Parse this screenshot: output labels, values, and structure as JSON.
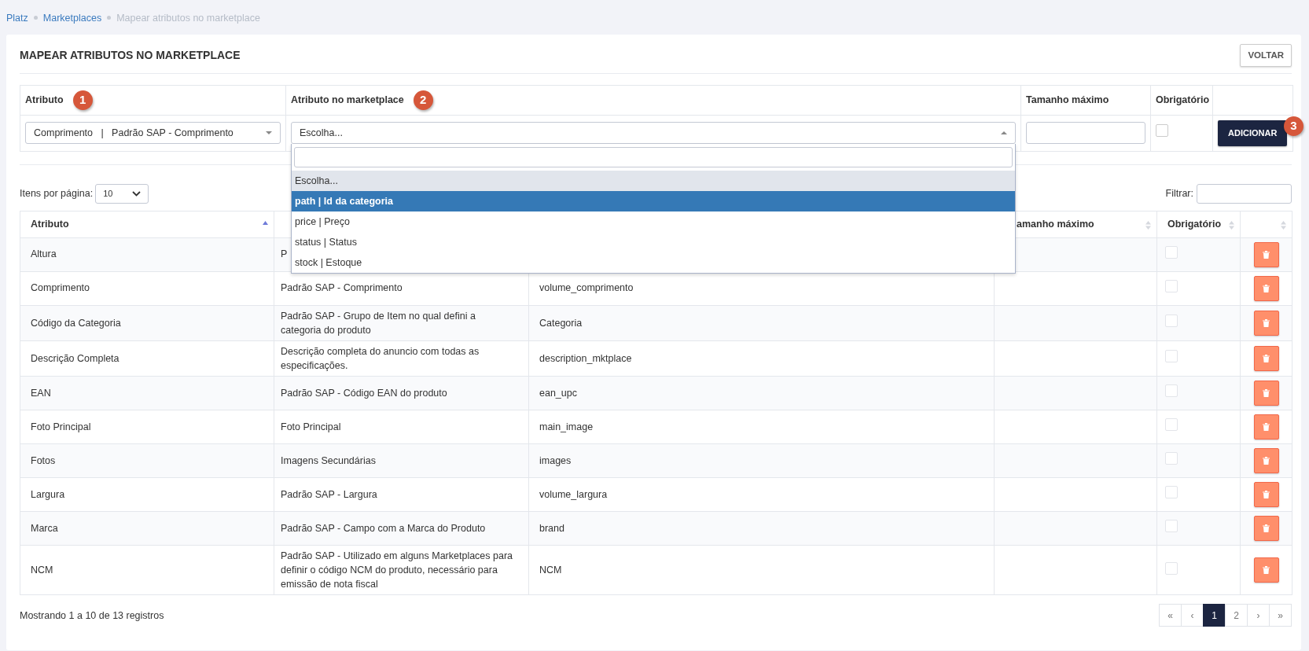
{
  "breadcrumb": [
    {
      "label": "Platz",
      "current": false
    },
    {
      "label": "Marketplaces",
      "current": false
    },
    {
      "label": "Mapear atributos no marketplace",
      "current": true
    }
  ],
  "page_title": "MAPEAR ATRIBUTOS NO MARKETPLACE",
  "back_button": "VOLTAR",
  "form": {
    "columns": [
      {
        "label": "Atributo",
        "marker": "1"
      },
      {
        "label": "Atributo no marketplace",
        "marker": "2"
      },
      {
        "label": "Tamanho máximo"
      },
      {
        "label": "Obrigatório"
      }
    ],
    "attribute_select": {
      "value": "Comprimento   |   Padrão SAP - Comprimento"
    },
    "marketplace_select": {
      "value": "Escolha...",
      "expanded": true,
      "options": [
        {
          "label": "Escolha...",
          "selected": true,
          "highlighted": false
        },
        {
          "label": "path | Id da categoria",
          "selected": false,
          "highlighted": true
        },
        {
          "label": "price | Preço",
          "selected": false,
          "highlighted": false
        },
        {
          "label": "status | Status",
          "selected": false,
          "highlighted": false
        },
        {
          "label": "stock | Estoque",
          "selected": false,
          "highlighted": false
        }
      ]
    },
    "required_checked": false,
    "add_button": {
      "label": "ADICIONAR",
      "marker": "3"
    }
  },
  "page_size": {
    "label": "Itens por página:",
    "value": "10"
  },
  "filter": {
    "label": "Filtrar:"
  },
  "table": {
    "columns": [
      {
        "label": "Atributo",
        "sorted": true
      },
      {},
      {},
      {
        "label": "amanho máximo",
        "sorted": false
      },
      {
        "label": "Obrigatório",
        "sorted": false
      },
      {
        "sorted": false
      }
    ],
    "rows": [
      {
        "attribute": "Altura",
        "description": "P",
        "marketplace_attribute": "",
        "required": false
      },
      {
        "attribute": "Comprimento",
        "description": "Padrão SAP - Comprimento",
        "marketplace_attribute": "volume_comprimento",
        "required": false
      },
      {
        "attribute": "Código da Categoria",
        "description": "Padrão SAP - Grupo de Item no qual defini a categoria do produto",
        "marketplace_attribute": "Categoria",
        "required": false
      },
      {
        "attribute": "Descrição Completa",
        "description": "Descrição completa do anuncio com todas as especificações.",
        "marketplace_attribute": "description_mktplace",
        "required": false
      },
      {
        "attribute": "EAN",
        "description": "Padrão SAP - Código EAN do produto",
        "marketplace_attribute": "ean_upc",
        "required": false
      },
      {
        "attribute": "Foto Principal",
        "description": "Foto Principal",
        "marketplace_attribute": "main_image",
        "required": false
      },
      {
        "attribute": "Fotos",
        "description": "Imagens Secundárias",
        "marketplace_attribute": "images",
        "required": false
      },
      {
        "attribute": "Largura",
        "description": "Padrão SAP - Largura",
        "marketplace_attribute": "volume_largura",
        "required": false
      },
      {
        "attribute": "Marca",
        "description": "Padrão SAP - Campo com a Marca do Produto",
        "marketplace_attribute": "brand",
        "required": false
      },
      {
        "attribute": "NCM",
        "description": "Padrão SAP - Utilizado em alguns Marketplaces para definir o código NCM do produto, necessário para emissão de nota fiscal",
        "marketplace_attribute": "NCM",
        "required": false
      }
    ]
  },
  "summary": "Mostrando 1 a 10 de 13 registros",
  "pagination": [
    {
      "label": "«",
      "selected": false
    },
    {
      "label": "‹",
      "selected": false
    },
    {
      "label": "1",
      "selected": true
    },
    {
      "label": "2",
      "selected": false
    },
    {
      "label": "›",
      "selected": false
    },
    {
      "label": "»",
      "selected": false
    }
  ]
}
